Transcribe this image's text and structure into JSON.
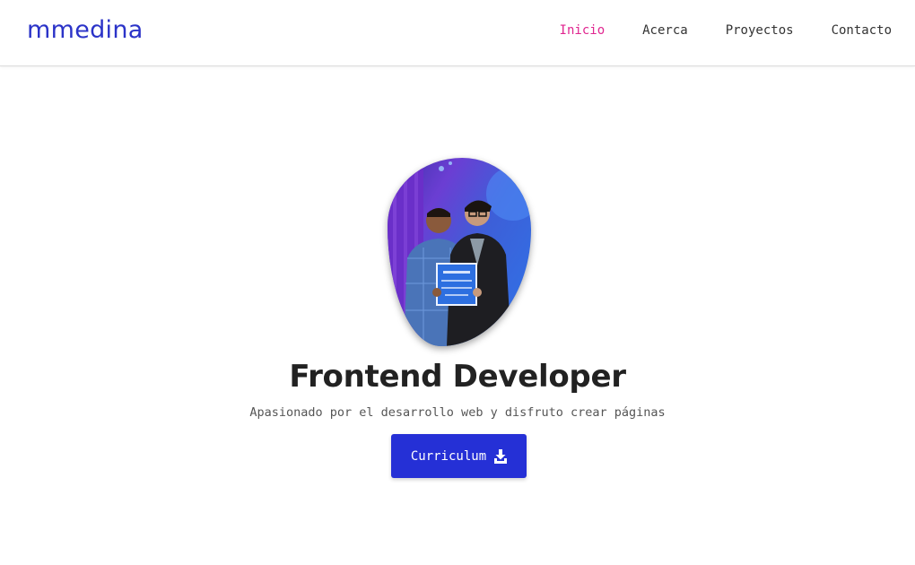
{
  "header": {
    "logo": "mmedina",
    "nav": [
      {
        "label": "Inicio",
        "active": true
      },
      {
        "label": "Acerca",
        "active": false
      },
      {
        "label": "Proyectos",
        "active": false
      },
      {
        "label": "Contacto",
        "active": false
      }
    ]
  },
  "hero": {
    "title": "Frontend Developer",
    "subtitle": "Apasionado por el desarrollo web y disfruto crear páginas",
    "button_label": "Curriculum",
    "button_icon": "download-icon"
  },
  "colors": {
    "brand": "#2b33c8",
    "active_nav": "#e0258f",
    "button": "#2530d6"
  }
}
